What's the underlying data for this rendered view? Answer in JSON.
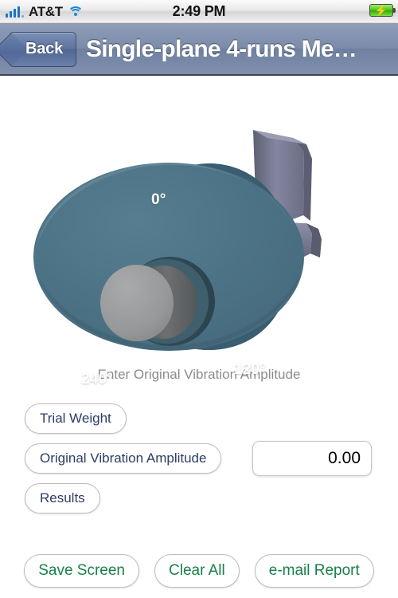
{
  "status_bar": {
    "signal_icon": "signal-bars-icon",
    "carrier": "AT&T",
    "wifi_icon": "wifi-icon",
    "time": "2:49 PM",
    "battery_icon": "battery-charging-icon",
    "battery_bolt": "⚡"
  },
  "nav_bar": {
    "back_label": "Back",
    "back_icon": "back-chevron-icon",
    "title": "Single-plane 4-runs Me…"
  },
  "illustration": {
    "name": "rotor-3d-illustration",
    "rotor_face_color": "#4d7386",
    "rotor_rim_color": "#3f6172",
    "hub_color": "#98999a",
    "bracket_color": "#797a90",
    "labels": [
      {
        "text": "0°",
        "position": "top"
      },
      {
        "text": "120°",
        "position": "lower-right"
      },
      {
        "text": "240°",
        "position": "lower-left"
      }
    ]
  },
  "instruction": "Enter Original Vibration Amplitude",
  "form": {
    "trial_weight_label": "Trial Weight",
    "original_amplitude_label": "Original Vibration Amplitude",
    "results_label": "Results",
    "amplitude_value": "0.00",
    "amplitude_placeholder": "0.00"
  },
  "toolbar": {
    "save_label": "Save Screen",
    "clear_label": "Clear All",
    "email_label": "e-mail Report",
    "accent_green": "#178148",
    "accent_navy": "#2e3c66"
  }
}
